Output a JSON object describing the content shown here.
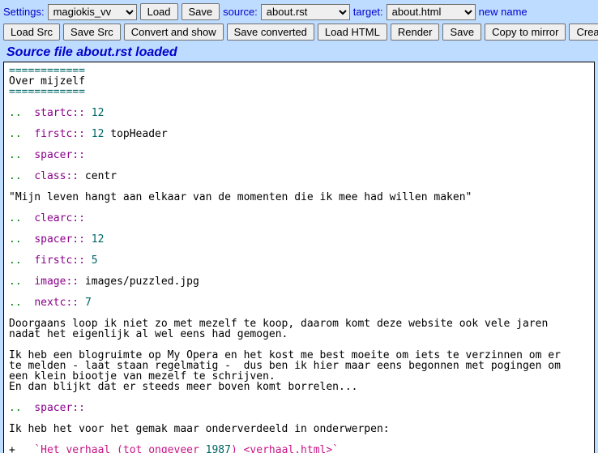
{
  "toolbar": {
    "settings_label": "Settings:",
    "settings_value": "magiokis_vv",
    "load_btn": "Load",
    "save_btn": "Save",
    "source_label": "source:",
    "source_value": "about.rst",
    "target_label": "target:",
    "target_value": "about.html",
    "new_name_link": "new name",
    "row2": {
      "load_src": "Load Src",
      "save_src": "Save Src",
      "convert_show": "Convert and show",
      "save_converted": "Save converted",
      "load_html": "Load HTML",
      "render": "Render",
      "save": "Save",
      "copy_mirror": "Copy to mirror",
      "create": "Create"
    }
  },
  "status": "Source file about.rst loaded",
  "rst": {
    "rule": "============",
    "title": "Over mijzelf",
    "lines": [
      {
        "dir": "startc",
        "arg_num": "12",
        "arg_txt": ""
      },
      {
        "dir": "firstc",
        "arg_num": "12",
        "arg_txt": " topHeader"
      },
      {
        "dir": "spacer",
        "arg_num": "",
        "arg_txt": ""
      },
      {
        "dir": "class",
        "arg_num": "",
        "arg_txt": " centr"
      },
      {
        "quote": "\"Mijn leven hangt aan elkaar van de momenten die ik mee had willen maken\""
      },
      {
        "dir": "clearc",
        "arg_num": "",
        "arg_txt": ""
      },
      {
        "dir": "spacer",
        "arg_num": "12",
        "arg_txt": ""
      },
      {
        "dir": "firstc",
        "arg_num": "5",
        "arg_txt": ""
      },
      {
        "dir": "image",
        "arg_num": "",
        "arg_txt": " images/puzzled.jpg"
      },
      {
        "dir": "nextc",
        "arg_num": "7",
        "arg_txt": ""
      }
    ],
    "para1_l1": "Doorgaans loop ik niet zo met mezelf te koop, daarom komt deze website ook vele jaren",
    "para1_l2": "nadat het eigenlijk al wel eens had gemogen.",
    "para2_l1": "Ik heb een blogruimte op My Opera en het kost me best moeite om iets te verzinnen om er",
    "para2_l2": "te melden - laat staan regelmatig -  dus ben ik hier maar eens begonnen met pogingen om",
    "para2_l3": "een klein biootje van mezelf te schrijven.",
    "para2_l4": "En dan blijkt dat er steeds meer boven komt borrelen...",
    "spacer2_dir": "spacer",
    "para3": "Ik heb het voor het gemak maar onderverdeeld in onderwerpen:",
    "bullet_pre": "+   ",
    "bullet_link_a": "`Het verhaal (tot ongeveer ",
    "bullet_link_year": "1987",
    "bullet_link_b": ") <verhaal.html>`"
  }
}
